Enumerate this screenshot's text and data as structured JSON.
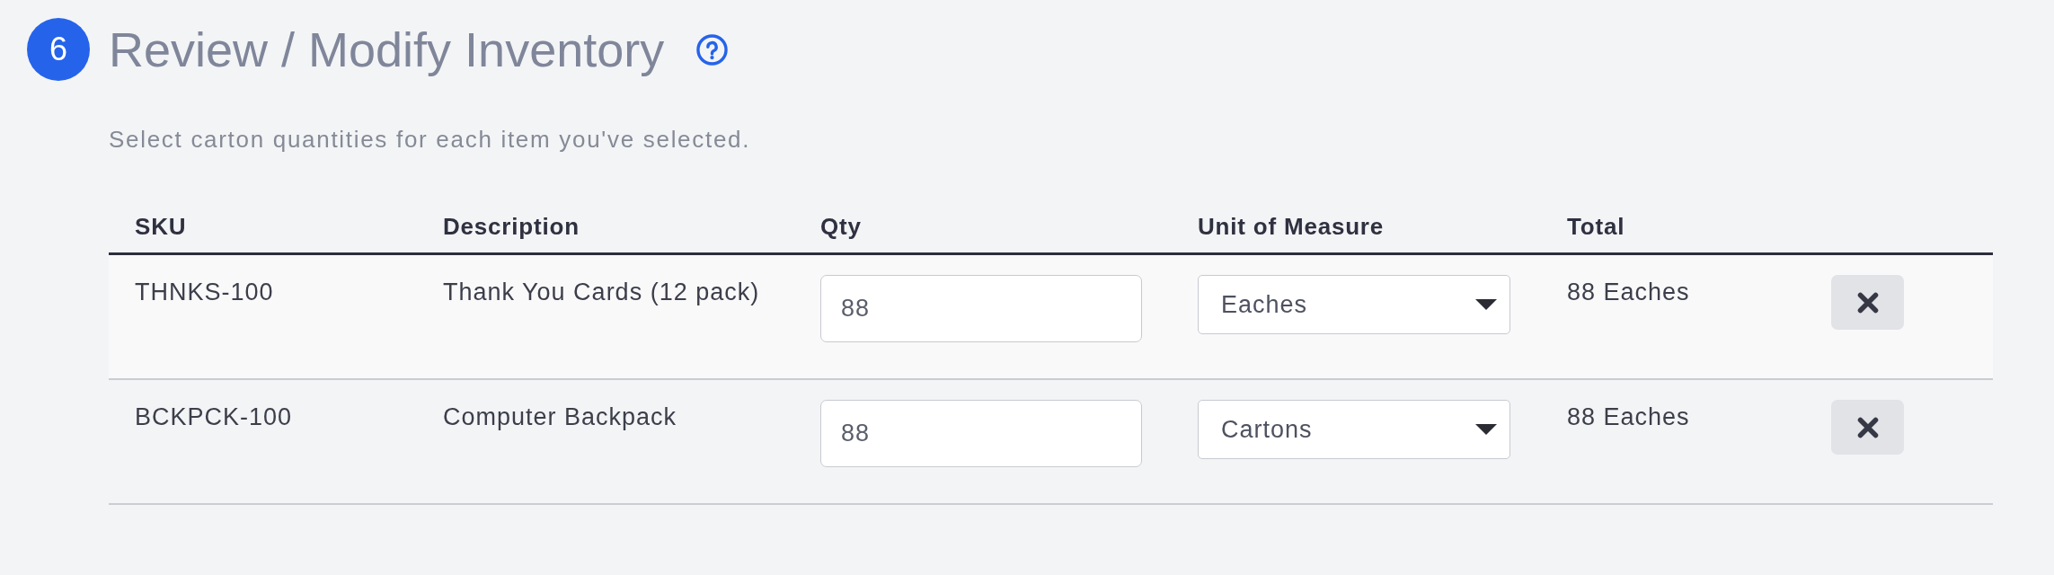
{
  "step": {
    "number": "6",
    "title": "Review / Modify Inventory"
  },
  "instructions": "Select carton quantities for each item you've selected.",
  "table": {
    "columns": [
      "SKU",
      "Description",
      "Qty",
      "Unit of Measure",
      "Total"
    ],
    "rows": [
      {
        "sku": "THNKS-100",
        "description": "Thank You Cards (12 pack)",
        "qty": "88",
        "unit": "Eaches",
        "total": "88 Eaches"
      },
      {
        "sku": "BCKPCK-100",
        "description": "Computer Backpack",
        "qty": "88",
        "unit": "Cartons",
        "total": "88 Eaches"
      }
    ]
  }
}
